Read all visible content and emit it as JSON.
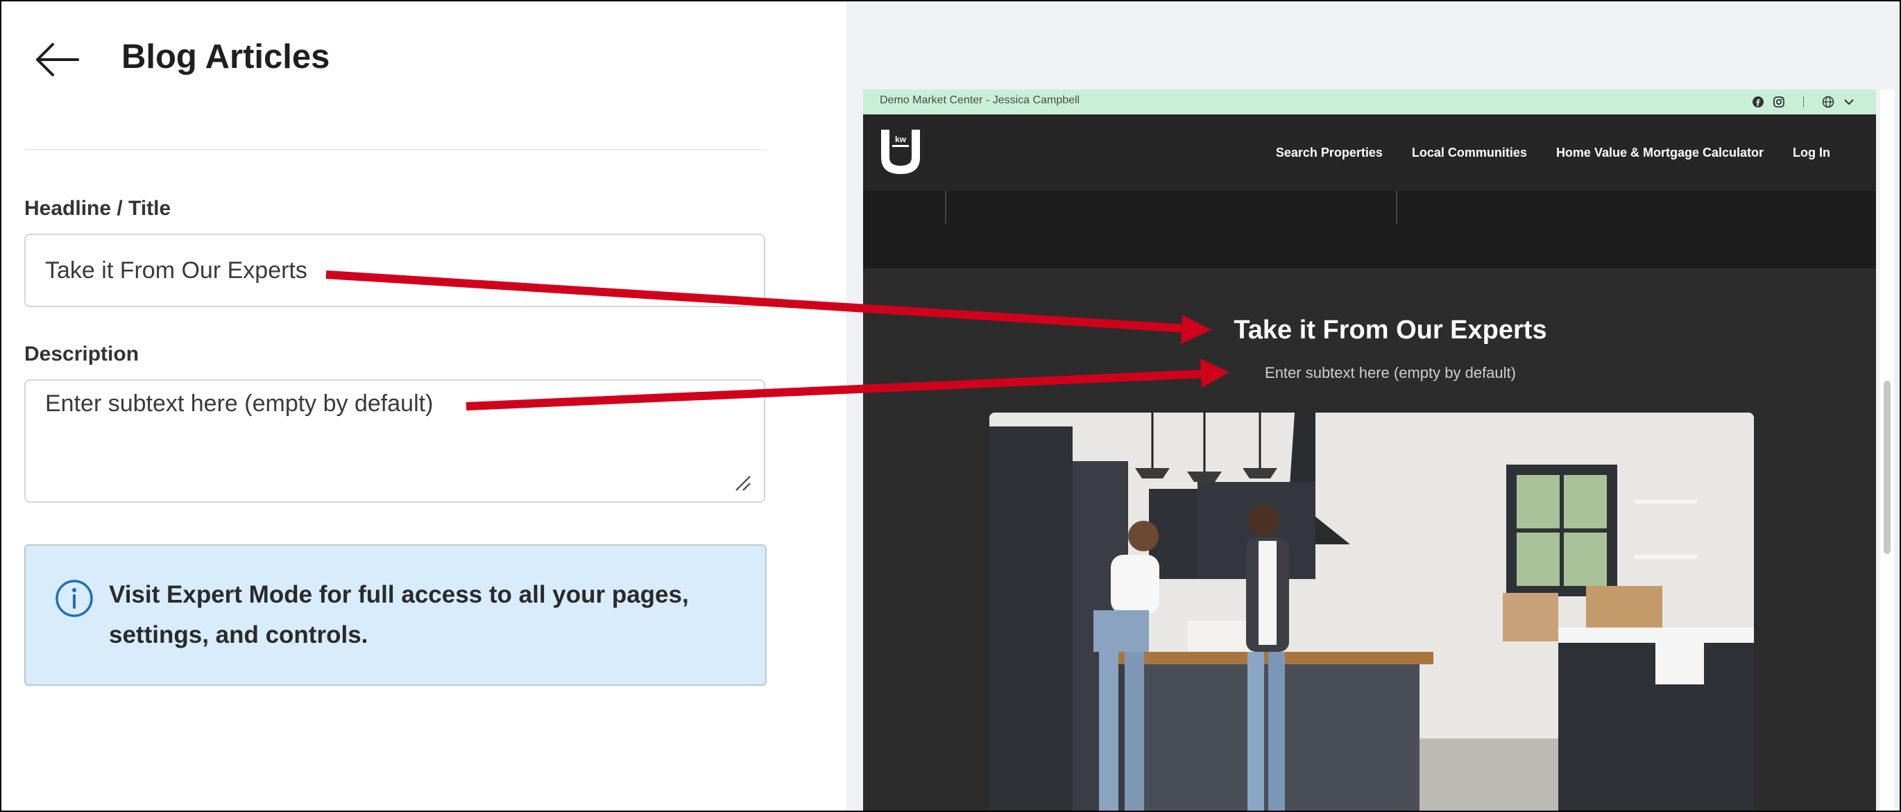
{
  "editor": {
    "title": "Blog Articles",
    "headline_label": "Headline / Title",
    "headline_value": "Take it From Our Experts",
    "description_label": "Description",
    "description_value": "Enter subtext here (empty by default)",
    "info_text": "Visit Expert Mode for full access to all your pages, settings, and controls."
  },
  "preview": {
    "topbar_text": "Demo Market Center - Jessica Campbell",
    "nav": [
      "Search Properties",
      "Local Communities",
      "Home Value & Mortgage Calculator",
      "Log In"
    ],
    "headline": "Take it From Our Experts",
    "subtext": "Enter subtext here (empty by default)"
  },
  "colors": {
    "annotation_arrow": "#d0021b",
    "info_bg": "#d8ecfb",
    "preview_bg": "#2c2c2c",
    "topbar_bg": "#c9f0d6"
  }
}
